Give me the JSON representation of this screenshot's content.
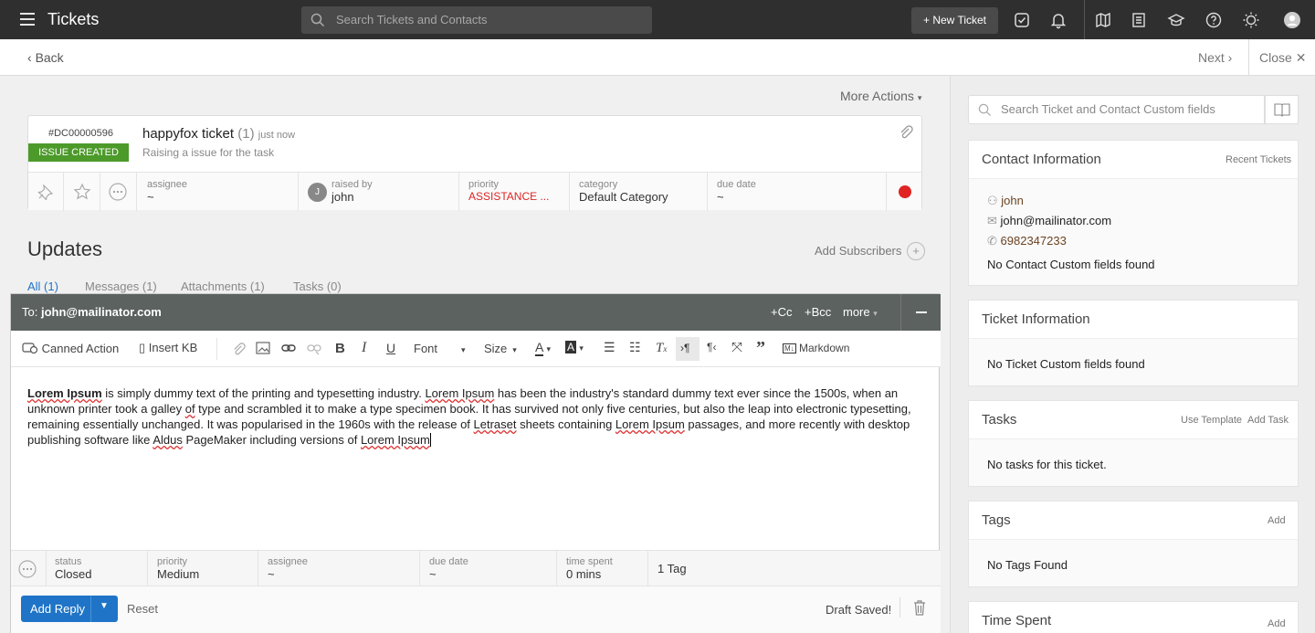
{
  "app": {
    "title": "Tickets",
    "search_placeholder": "Search Tickets and Contacts",
    "new_ticket": "+ New Ticket"
  },
  "nav": {
    "back": "Back",
    "next": "Next",
    "close": "Close"
  },
  "main": {
    "more_actions": "More Actions",
    "ticket": {
      "id": "#DC00000596",
      "status": "ISSUE CREATED",
      "subject": "happyfox ticket",
      "count": "(1)",
      "time": "just now",
      "description": "Raising a issue for the task",
      "assignee_label": "assignee",
      "assignee_value": "~",
      "raised_by_label": "raised by",
      "raised_by_value": "john",
      "raised_by_initial": "J",
      "priority_label": "priority",
      "priority_value": "ASSISTANCE ...",
      "category_label": "category",
      "category_value": "Default Category",
      "due_label": "due date",
      "due_value": "~",
      "status_dot_color": "#e02424"
    },
    "updates_title": "Updates",
    "add_subscribers": "Add Subscribers",
    "tabs": [
      "All (1)",
      "Messages (1)",
      "Attachments (1)",
      "Tasks (0)"
    ]
  },
  "reply": {
    "to_label": "To:",
    "to_value": "john@mailinator.com",
    "cc": "+Cc",
    "bcc": "+Bcc",
    "more": "more",
    "canned_action": "Canned Action",
    "insert_kb": "Insert KB",
    "font": "Font",
    "size": "Size",
    "markdown": "Markdown",
    "body_parts": [
      "Lorem Ipsum",
      " is simply dummy text of the printing and typesetting industry. ",
      "Lorem Ipsum",
      " has been the industry's standard dummy text ever since the 1500s, when an unknown printer took a galley ",
      "of",
      " type and scrambled it to make a type specimen book. It has survived not only five centuries, but also the leap into electronic typesetting, remaining essentially unchanged. It was popularised in the 1960s with the release of ",
      "Letraset",
      " sheets containing ",
      "Lorem Ipsum",
      " passages, and more recently with desktop publishing software like ",
      "Aldus",
      " PageMaker including versions of ",
      "Lorem Ipsum"
    ],
    "status_label": "status",
    "status_value": "Closed",
    "priority_label": "priority",
    "priority_value": "Medium",
    "assignee_label": "assignee",
    "assignee_value": "~",
    "due_label": "due date",
    "due_value": "~",
    "time_label": "time spent",
    "time_value": "0 mins",
    "tags_value": "1 Tag",
    "add_reply": "Add Reply",
    "reset": "Reset",
    "draft": "Draft Saved!"
  },
  "sidebar": {
    "search_placeholder": "Search Ticket and Contact Custom fields",
    "contact": {
      "title": "Contact Information",
      "link": "Recent Tickets",
      "name": "john",
      "email": "john@mailinator.com",
      "phone": "6982347233",
      "note": "No Contact Custom fields found"
    },
    "ticket_info": {
      "title": "Ticket Information",
      "note": "No Ticket Custom fields found"
    },
    "tasks": {
      "title": "Tasks",
      "link1": "Use Template",
      "link2": "Add Task",
      "note": "No tasks for this ticket."
    },
    "tags": {
      "title": "Tags",
      "link": "Add",
      "note": "No Tags Found"
    },
    "time_spent": {
      "title": "Time Spent",
      "link": "Add"
    }
  }
}
